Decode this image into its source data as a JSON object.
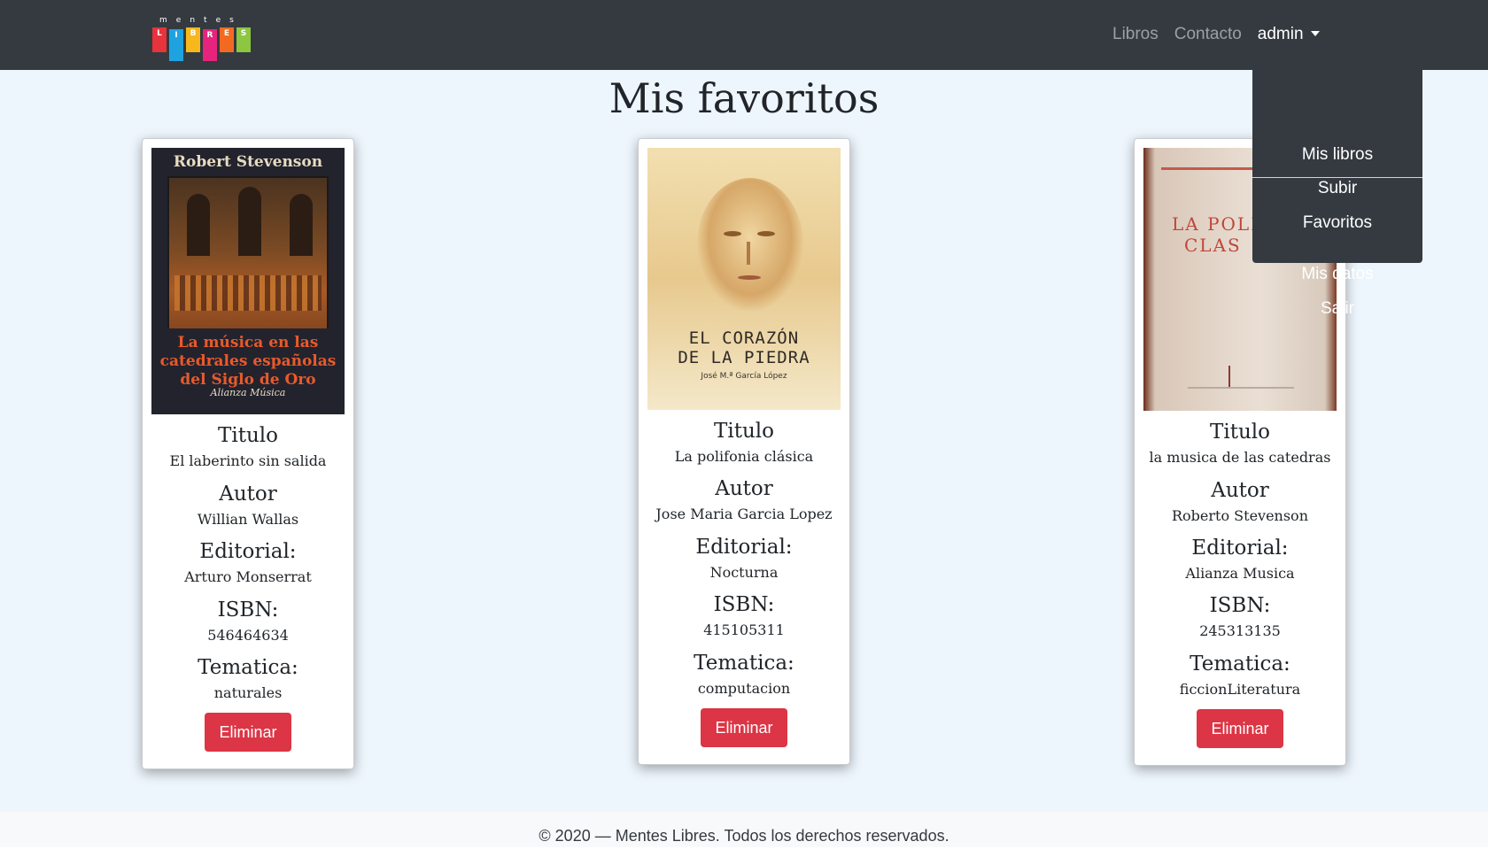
{
  "brand": {
    "top_letters": [
      "m",
      "e",
      "n",
      "t",
      "e",
      "s"
    ],
    "block_letters": [
      "L",
      "I",
      "B",
      "R",
      "E",
      "S"
    ],
    "block_colors": [
      "#e8323c",
      "#1fa3e0",
      "#f7b81d",
      "#e6247d",
      "#f26a21",
      "#8dc63f"
    ]
  },
  "nav": {
    "links": [
      "Libros",
      "Contacto"
    ],
    "user": "admin"
  },
  "dropdown": {
    "items": [
      "Mis libros",
      "Subir",
      "Favoritos"
    ],
    "items_after_divider": [
      "Mis datos",
      "Salir"
    ]
  },
  "page": {
    "title": "Mis favoritos"
  },
  "labels": {
    "titulo": "Titulo",
    "autor": "Autor",
    "editorial": "Editorial:",
    "isbn": "ISBN:",
    "tematica": "Tematica:",
    "remove": "Eliminar"
  },
  "books": [
    {
      "titulo": "El laberinto sin salida",
      "autor": "Willian Wallas",
      "editorial": "Arturo Monserrat",
      "isbn": "546464634",
      "tematica": "naturales",
      "cover": {
        "author_text": "Robert Stevenson",
        "title_lines": [
          "La música en las",
          "catedrales españolas",
          "del Siglo de Oro"
        ],
        "publisher_text": "Alianza Música"
      }
    },
    {
      "titulo": "La polifonia clásica",
      "autor": "Jose Maria Garcia Lopez",
      "editorial": "Nocturna",
      "isbn": "415105311",
      "tematica": "computacion",
      "cover": {
        "title_lines": [
          "EL CORAZÓN",
          "DE LA PIEDRA"
        ],
        "author_text": "José M.ª García López"
      }
    },
    {
      "titulo": "la musica de las catedras",
      "autor": "Roberto Stevenson",
      "editorial": "Alianza Musica",
      "isbn": "245313135",
      "tematica": "ficcionLiteratura",
      "cover": {
        "title_lines": [
          "LA POLIF",
          "CLAS"
        ]
      }
    }
  ],
  "footer": {
    "text": "© 2020 — Mentes Libres. Todos los derechos reservados."
  }
}
